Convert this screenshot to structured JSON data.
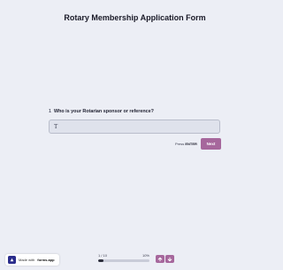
{
  "form": {
    "title": "Rotary Membership Application Form"
  },
  "question": {
    "number": "1",
    "text": "Who is your Rotarian sponsor or reference?",
    "answer_value": "",
    "answer_placeholder": "",
    "field_icon": "text-type-icon",
    "field_icon_glyph": "T"
  },
  "actions": {
    "press_label": "Press",
    "press_key": "ENTER",
    "next_label": "Next"
  },
  "branding": {
    "made_with_label": "Made with",
    "brand_name": "forms.app",
    "logo_icon": "forms-app-logo"
  },
  "progress": {
    "step_label": "1 / 10",
    "percent_label": "10%",
    "fraction": 0.1
  },
  "navigation": {
    "up_icon": "arrow-up-icon",
    "down_icon": "arrow-down-icon"
  },
  "colors": {
    "background": "#eceef5",
    "accent": "#a6679c",
    "progress_fill": "#2c2e3c",
    "input_background": "#dfe2ec"
  }
}
